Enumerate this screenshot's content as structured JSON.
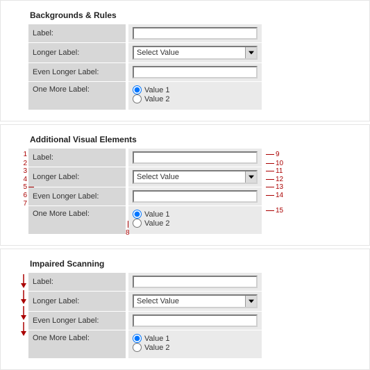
{
  "sections": {
    "a": {
      "heading": "Backgrounds & Rules"
    },
    "b": {
      "heading": "Additional Visual Elements"
    },
    "c": {
      "heading": "Impaired Scanning"
    }
  },
  "labels": {
    "r0": "Label:",
    "r1": "Longer Label:",
    "r2": "Even Longer Label:",
    "r3": "One More Label:"
  },
  "select": {
    "value": "Select Value"
  },
  "radios": {
    "opt1": "Value 1",
    "opt2": "Value 2"
  },
  "ann": {
    "l1": "1",
    "l2": "2",
    "l3": "3",
    "l4": "4",
    "l5": "5",
    "l6": "6",
    "l7": "7",
    "b8": "8",
    "r9": "9",
    "r10": "10",
    "r11": "11",
    "r12": "12",
    "r13": "13",
    "r14": "14",
    "r15": "15"
  }
}
